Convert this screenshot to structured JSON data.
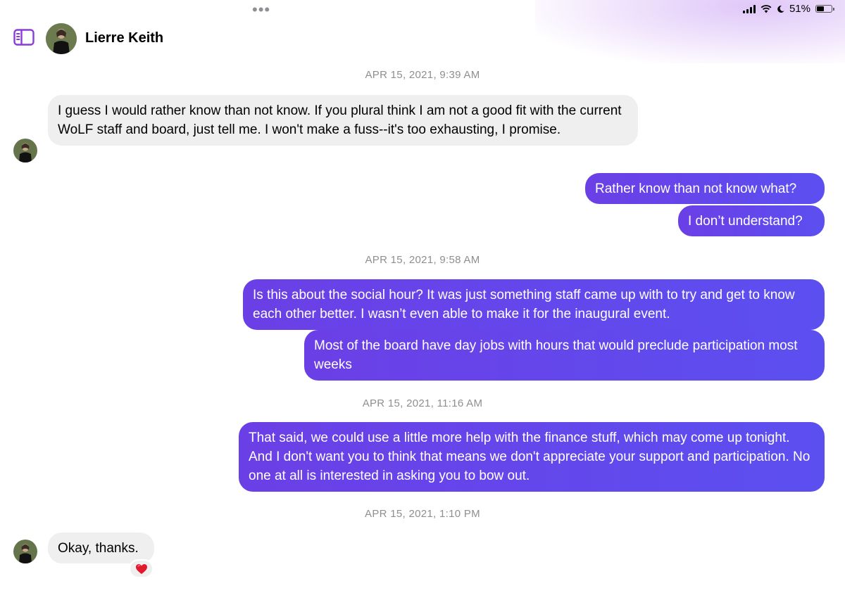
{
  "status_bar": {
    "battery_text": "51%",
    "battery_level": 0.51
  },
  "header": {
    "contact_name": "Lierre Keith"
  },
  "colors": {
    "outgoing_start": "#6b3fe6",
    "outgoing_end": "#5c4ff0",
    "incoming": "#efefef",
    "accent": "#8a3bd8"
  },
  "messages": [
    {
      "type": "timestamp",
      "text": "APR 15, 2021, 9:39 AM"
    },
    {
      "type": "incoming",
      "text": "I guess I would rather know than not know. If you plural think I am not a good fit with the current WoLF staff and board, just tell me. I won't make a fuss--it's too exhausting, I promise."
    },
    {
      "type": "outgoing",
      "text": "Rather know than not know what?"
    },
    {
      "type": "outgoing",
      "text": "I don’t understand?"
    },
    {
      "type": "timestamp",
      "text": "APR 15, 2021, 9:58 AM"
    },
    {
      "type": "outgoing",
      "text": "Is this about the social hour? It was just something staff came up with to try and get to know each other better. I wasn’t even able to make it for the inaugural event."
    },
    {
      "type": "outgoing",
      "text": "Most of the board have day jobs with hours that would preclude participation most weeks"
    },
    {
      "type": "timestamp",
      "text": "APR 15, 2021, 11:16 AM"
    },
    {
      "type": "outgoing",
      "text": "That said, we could use a little more help with the finance stuff,  which may come up tonight. And I don't want you to think that means we don't appreciate your support and participation. No one at all is interested in asking you to bow out."
    },
    {
      "type": "timestamp",
      "text": "APR 15, 2021, 1:10 PM"
    },
    {
      "type": "incoming",
      "text": "Okay, thanks.",
      "reaction": "heart"
    }
  ]
}
